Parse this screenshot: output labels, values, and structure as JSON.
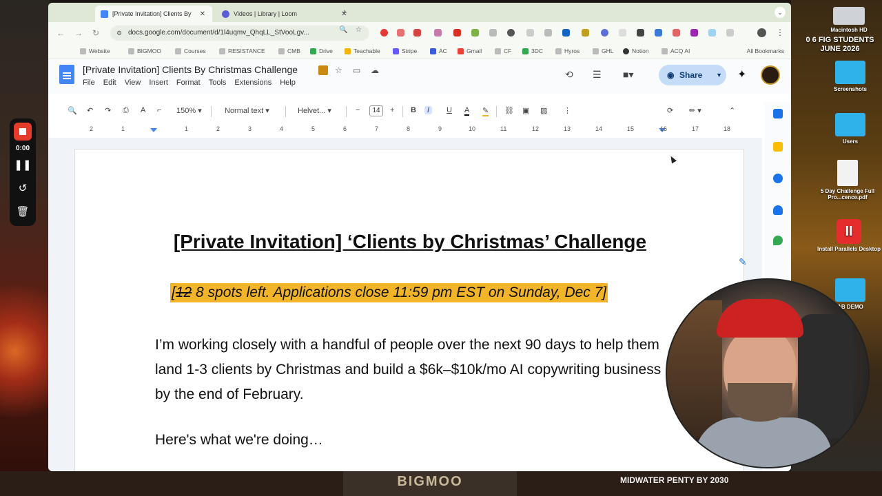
{
  "browser": {
    "tabs": [
      {
        "title": "[Private Invitation] Clients By",
        "active": true
      },
      {
        "title": "Videos | Library | Loom",
        "active": false
      }
    ],
    "url": "docs.google.com/document/d/1l4uqmv_QhqLL_StVooLgv...",
    "bookmarks": [
      "Website",
      "BIGMOO",
      "Courses",
      "RESISTANCE",
      "CMB",
      "Drive",
      "Teachable",
      "Stripe",
      "AC",
      "Gmail",
      "CF",
      "3DC",
      "Hyros",
      "GHL",
      "Notion",
      "ACQ AI"
    ],
    "all_bookmarks": "All Bookmarks"
  },
  "docs": {
    "title": "[Private Invitation] Clients By Christmas Challenge",
    "menus": [
      "File",
      "Edit",
      "View",
      "Insert",
      "Format",
      "Tools",
      "Extensions",
      "Help"
    ],
    "share_label": "Share",
    "toolbar": {
      "zoom": "150%",
      "style": "Normal text",
      "font": "Helvet...",
      "font_size": "14"
    },
    "ruler": [
      "2",
      "1",
      "1",
      "2",
      "3",
      "4",
      "5",
      "6",
      "7",
      "8",
      "9",
      "10",
      "11",
      "12",
      "13",
      "14",
      "15",
      "16",
      "17",
      "18"
    ]
  },
  "document": {
    "heading": "[Private Invitation] ‘Clients by Christmas’ Challenge",
    "highlight_open": "[",
    "highlight_struck": "12",
    "highlight_rest": " 8 spots left. Applications close 11:59 pm EST on Sunday, Dec 7]",
    "paragraph": "I’m working closely with a handful of people over the next 90 days to help them land 1-3 clients by Christmas and build a $6k–$10k/mo AI copywriting business by the end of February.",
    "paragraph2": "Here's what we're doing…"
  },
  "recorder": {
    "time": "0:00"
  },
  "desktop": {
    "items": [
      "Macintosh HD",
      "Screenshots",
      "Users",
      "5 Day Challenge Full Pro...cence.pdf",
      "Install Parallels Desktop",
      "AB DEMO"
    ],
    "promo": "0 6 FIG STUDENTS JUNE 2026",
    "bottom_banner": "BIGMOO",
    "bottom_caption": "MIDWATER PENTY BY 2030"
  },
  "colors": {
    "highlight": "#f2b529",
    "share_bg": "#c4dcf8",
    "docs_blue": "#4285f4",
    "rec_red": "#e53b2a"
  }
}
